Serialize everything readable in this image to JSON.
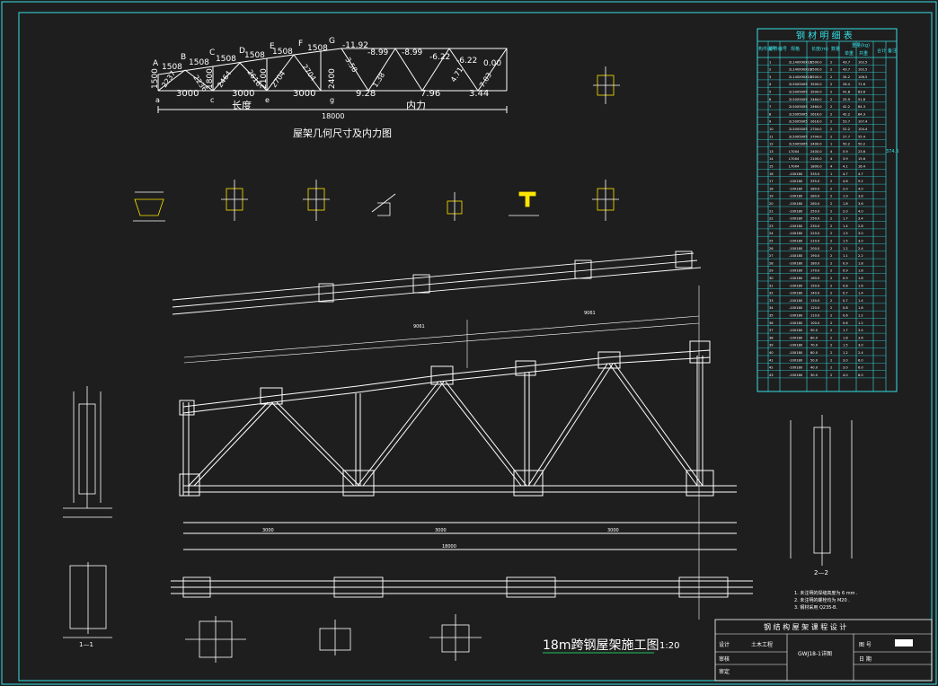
{
  "geometry_diagram": {
    "node_labels": [
      "A",
      "B",
      "C",
      "D",
      "E",
      "F",
      "G"
    ],
    "bottom_labels": [
      "a",
      "c",
      "e",
      "g"
    ],
    "top_values": [
      "1508",
      "1508",
      "1508",
      "1508",
      "1508",
      "1508"
    ],
    "top_forces": [
      "-11.92",
      "-8.99",
      "-8.99",
      "-6.22",
      "-6.22",
      "0.00"
    ],
    "heights": [
      "1500",
      "1800",
      "2100",
      "2400"
    ],
    "panel_lengths": [
      "3000",
      "3000",
      "3000"
    ],
    "bottom_forces": [
      "9.28",
      "7.96",
      "3.44"
    ],
    "web_values": [
      "2237",
      "2236",
      "2464",
      "2616",
      "2704",
      "2704",
      "1.38",
      "3.58",
      "4.71",
      "7.03"
    ],
    "length_label": "长度",
    "force_label": "内力",
    "span_dimension": "18000",
    "caption": "屋架几何尺寸及内力图"
  },
  "material_table": {
    "title": "钢 材 明 细 表",
    "headers": {
      "member_no": "构件编号",
      "part_no": "零件编号",
      "spec": "规格",
      "length": "长度(m)",
      "qty": "数量",
      "weight": "重量(kg)",
      "unit_weight": "单重",
      "total_weight": "共重",
      "sum": "合计",
      "note": "备注"
    },
    "total": "374.6",
    "rows": [
      [
        "1",
        "2L140X90X10",
        "3500.0",
        "2",
        "43.7",
        "102.5"
      ],
      [
        "2",
        "2L140X90X10",
        "3500.0",
        "2",
        "43.7",
        "102.5"
      ],
      [
        "3",
        "2L140X90X10",
        "3500.0",
        "2",
        "34.2",
        "106.5"
      ],
      [
        "4",
        "2L50X50X5",
        "3500.0",
        "2",
        "26.4",
        "71.6"
      ],
      [
        "5",
        "2L50X50X5",
        "3500.0",
        "2",
        "41.8",
        "83.6"
      ],
      [
        "6",
        "2L50X50X5",
        "2464.0",
        "2",
        "25.9",
        "51.8"
      ],
      [
        "7",
        "2L50X50X5",
        "2464.0",
        "2",
        "42.2",
        "84.3"
      ],
      [
        "8",
        "2L50X50X5",
        "2616.0",
        "2",
        "42.2",
        "84.3"
      ],
      [
        "9",
        "2L50X50X5",
        "2616.0",
        "2",
        "53.7",
        "107.4"
      ],
      [
        "10",
        "2L50X50X5",
        "2704.0",
        "2",
        "52.2",
        "104.4"
      ],
      [
        "11",
        "2L50X50X5",
        "2704.0",
        "2",
        "27.7",
        "55.4"
      ],
      [
        "12",
        "2L50X50X5",
        "2400.0",
        "1",
        "50.2",
        "50.2"
      ],
      [
        "13",
        "L70X4",
        "2400.0",
        "4",
        "5.9",
        "23.6"
      ],
      [
        "14",
        "L70X4",
        "2100.0",
        "4",
        "3.9",
        "15.6"
      ],
      [
        "15",
        "L70X4",
        "1800.0",
        "4",
        "4.1",
        "16.4"
      ],
      [
        "16",
        "-10X180",
        "335.0",
        "1",
        "4.7",
        "4.7"
      ],
      [
        "17",
        "-10X180",
        "335.0",
        "2",
        "4.6",
        "9.2"
      ],
      [
        "18",
        "-10X180",
        "280.0",
        "2",
        "2.0",
        "4.0"
      ],
      [
        "19",
        "-10X180",
        "280.0",
        "2",
        "1.9",
        "3.8"
      ],
      [
        "20",
        "-10X180",
        "260.0",
        "2",
        "1.8",
        "3.6"
      ],
      [
        "21",
        "-10X180",
        "250.0",
        "2",
        "2.0",
        "4.0"
      ],
      [
        "22",
        "-10X180",
        "250.0",
        "2",
        "1.7",
        "3.4"
      ],
      [
        "23",
        "-10X180",
        "230.0",
        "2",
        "1.4",
        "2.8"
      ],
      [
        "24",
        "-10X180",
        "220.0",
        "2",
        "1.5",
        "3.0"
      ],
      [
        "25",
        "-10X180",
        "210.0",
        "2",
        "1.5",
        "3.0"
      ],
      [
        "26",
        "-10X180",
        "200.0",
        "2",
        "1.2",
        "2.4"
      ],
      [
        "27",
        "-10X180",
        "190.0",
        "2",
        "1.1",
        "2.2"
      ],
      [
        "28",
        "-10X180",
        "180.0",
        "2",
        "0.9",
        "1.8"
      ],
      [
        "29",
        "-10X180",
        "170.0",
        "2",
        "0.9",
        "1.8"
      ],
      [
        "30",
        "-10X180",
        "160.0",
        "2",
        "0.9",
        "1.8"
      ],
      [
        "31",
        "-10X180",
        "150.0",
        "2",
        "0.8",
        "1.6"
      ],
      [
        "32",
        "-10X180",
        "140.0",
        "2",
        "0.7",
        "1.4"
      ],
      [
        "33",
        "-10X180",
        "130.0",
        "2",
        "0.7",
        "1.4"
      ],
      [
        "34",
        "-10X180",
        "120.0",
        "2",
        "0.8",
        "1.6"
      ],
      [
        "35",
        "-10X180",
        "110.0",
        "2",
        "0.6",
        "1.2"
      ],
      [
        "36",
        "-10X180",
        "100.0",
        "2",
        "0.6",
        "1.2"
      ],
      [
        "37",
        "-10X180",
        "90.0",
        "2",
        "1.7",
        "3.4"
      ],
      [
        "38",
        "-10X180",
        "80.0",
        "2",
        "1.8",
        "3.6"
      ],
      [
        "39",
        "-10X180",
        "70.0",
        "2",
        "1.5",
        "3.0"
      ],
      [
        "40",
        "-10X180",
        "60.0",
        "2",
        "1.2",
        "2.4"
      ],
      [
        "41",
        "-10X180",
        "50.0",
        "2",
        "3.0",
        "6.0"
      ],
      [
        "42",
        "-10X180",
        "40.0",
        "2",
        "3.0",
        "6.0"
      ],
      [
        "43",
        "-10X180",
        "30.0",
        "2",
        "4.0",
        "8.0"
      ]
    ]
  },
  "truss_drawing": {
    "title": "18m跨钢屋架施工图",
    "scale": "1:20",
    "total_span": "18000",
    "panel_dims": [
      "3000",
      "3000",
      "3000"
    ],
    "upper_dims": [
      "9061",
      "9061"
    ],
    "section_labels": [
      "1—1",
      "2—2"
    ]
  },
  "notes": [
    "1. 未注明的焊缝高度为 6 mm .",
    "2. 未注明的螺栓均为 M20 .",
    "3. 钢材采用 Q235-B."
  ],
  "title_block": {
    "header": "钢 结 构 屋 架 课 程 设 计",
    "drawing_name": "GWJ18-1详图",
    "rows": [
      "设计",
      "审核",
      "审定"
    ],
    "school": "土木工程",
    "sheet": "图 号",
    "date": "日 期"
  },
  "colors": {
    "background": "#1e1e1e",
    "frame": "#36e0e6",
    "lines": "#ffffff",
    "highlight": "#ffe600",
    "title_underline": "#22c55e"
  }
}
